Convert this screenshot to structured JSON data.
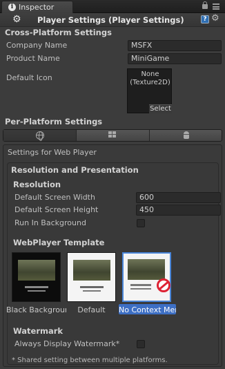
{
  "tab": {
    "label": "Inspector"
  },
  "header": {
    "title": "Player Settings (Player Settings)"
  },
  "cross_platform": {
    "title": "Cross-Platform Settings",
    "company_name_label": "Company Name",
    "company_name_value": "MSFX",
    "product_name_label": "Product Name",
    "product_name_value": "MiniGame",
    "default_icon_label": "Default Icon",
    "icon_none": "None",
    "icon_type": "(Texture2D)",
    "select_label": "Select"
  },
  "per_platform": {
    "title": "Per-Platform Settings",
    "platform_tabs": [
      "web-player",
      "windows-standalone",
      "android"
    ],
    "settings_for": "Settings for Web Player"
  },
  "resolution_presentation": {
    "title": "Resolution and Presentation",
    "resolution_title": "Resolution",
    "width_label": "Default Screen Width",
    "width_value": "600",
    "height_label": "Default Screen Height",
    "height_value": "450",
    "run_bg_label": "Run In Background",
    "run_bg_checked": false
  },
  "webplayer_template": {
    "title": "WebPlayer Template",
    "templates": [
      {
        "caption": "Black Background",
        "selected": false
      },
      {
        "caption": "Default",
        "selected": false
      },
      {
        "caption": "No Context Menu",
        "selected": true
      }
    ]
  },
  "watermark": {
    "title": "Watermark",
    "always_display_label": "Always Display Watermark*",
    "always_display_checked": false
  },
  "footnote": "* Shared setting between multiple platforms."
}
